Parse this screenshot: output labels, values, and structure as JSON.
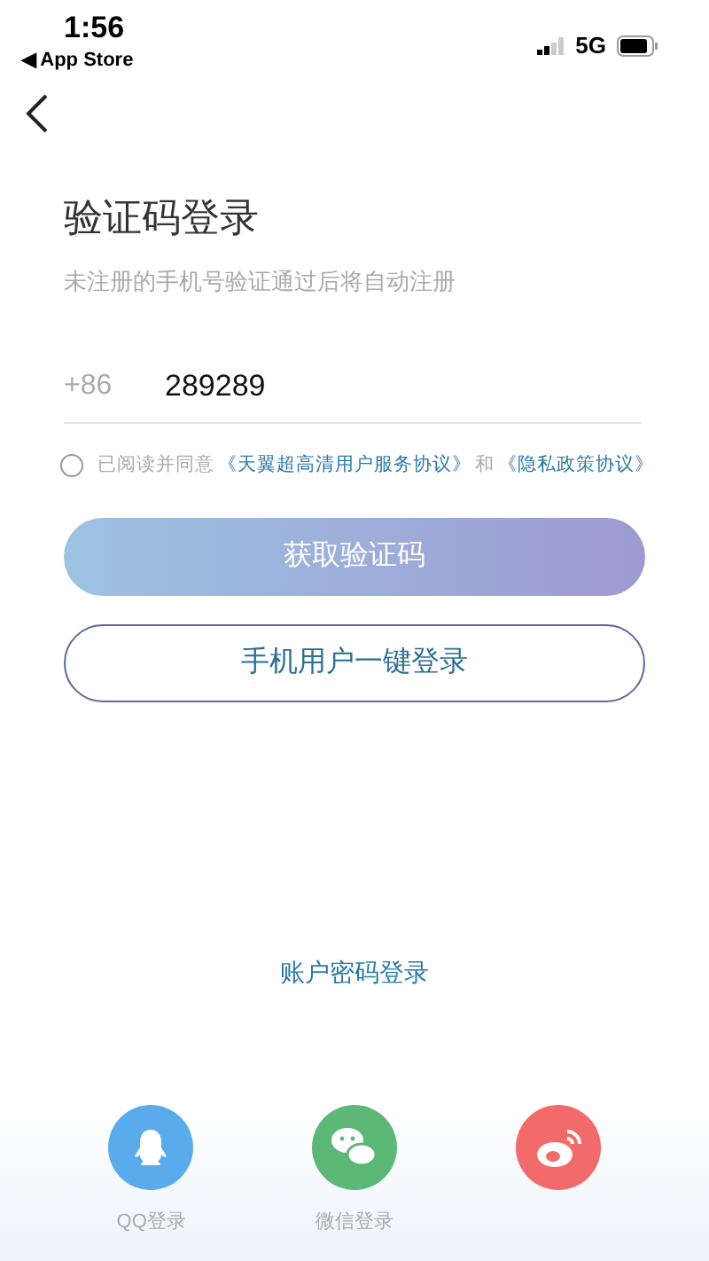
{
  "status_bar": {
    "time": "1:56",
    "back_app": "◀ App Store",
    "network": "5G"
  },
  "title": "验证码登录",
  "subtitle": "未注册的手机号验证通过后将自动注册",
  "phone": {
    "prefix": "+86",
    "value": "289289"
  },
  "agreement": {
    "checked": false,
    "parts": [
      {
        "kind": "text",
        "text": "已阅读并同意"
      },
      {
        "kind": "link",
        "text": "《天翼超高清用户服务协议》"
      },
      {
        "kind": "text",
        "text": "和"
      },
      {
        "kind": "link",
        "text": "《隐私政策协议》"
      }
    ]
  },
  "primary_button": "获取验证码",
  "secondary_button": "手机用户一键登录",
  "password_login": "账户密码登录",
  "social": [
    {
      "kind": "qq",
      "label": "QQ登录"
    },
    {
      "kind": "wechat",
      "label": "微信登录"
    },
    {
      "kind": "weibo"
    }
  ]
}
